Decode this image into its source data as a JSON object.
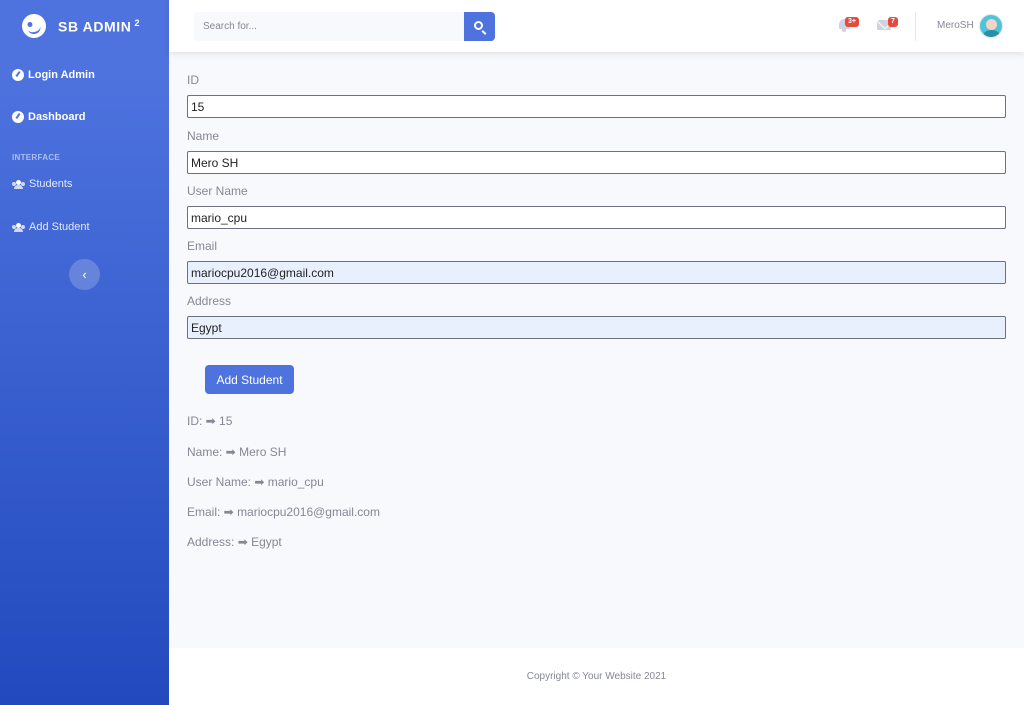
{
  "sidebar": {
    "brand": "SB ADMIN",
    "brand_sup": "2",
    "items": [
      {
        "label": "Login Admin"
      },
      {
        "label": "Dashboard"
      },
      {
        "label": "Students"
      },
      {
        "label": "Add Student"
      }
    ],
    "heading": "INTERFACE"
  },
  "topbar": {
    "search_placeholder": "Search for...",
    "alerts_badge": "3+",
    "messages_badge": "7",
    "username": "MeroSH"
  },
  "form": {
    "fields": [
      {
        "label": "ID",
        "value": "15"
      },
      {
        "label": "Name",
        "value": "Mero SH"
      },
      {
        "label": "User Name",
        "value": "mario_cpu"
      },
      {
        "label": "Email",
        "value": "mariocpu2016@gmail.com"
      },
      {
        "label": "Address",
        "value": "Egypt"
      }
    ],
    "submit_label": "Add Student"
  },
  "echo": [
    "ID: ➡ 15",
    "Name: ➡ Mero SH",
    "User Name: ➡ mario_cpu",
    "Email: ➡ mariocpu2016@gmail.com",
    "Address: ➡ Egypt"
  ],
  "footer": {
    "copyright": "Copyright © Your Website 2021"
  },
  "colors": {
    "primary": "#4e73df",
    "sidebar_end": "#224abe",
    "badge": "#e74a3b",
    "text_muted": "#858796"
  }
}
